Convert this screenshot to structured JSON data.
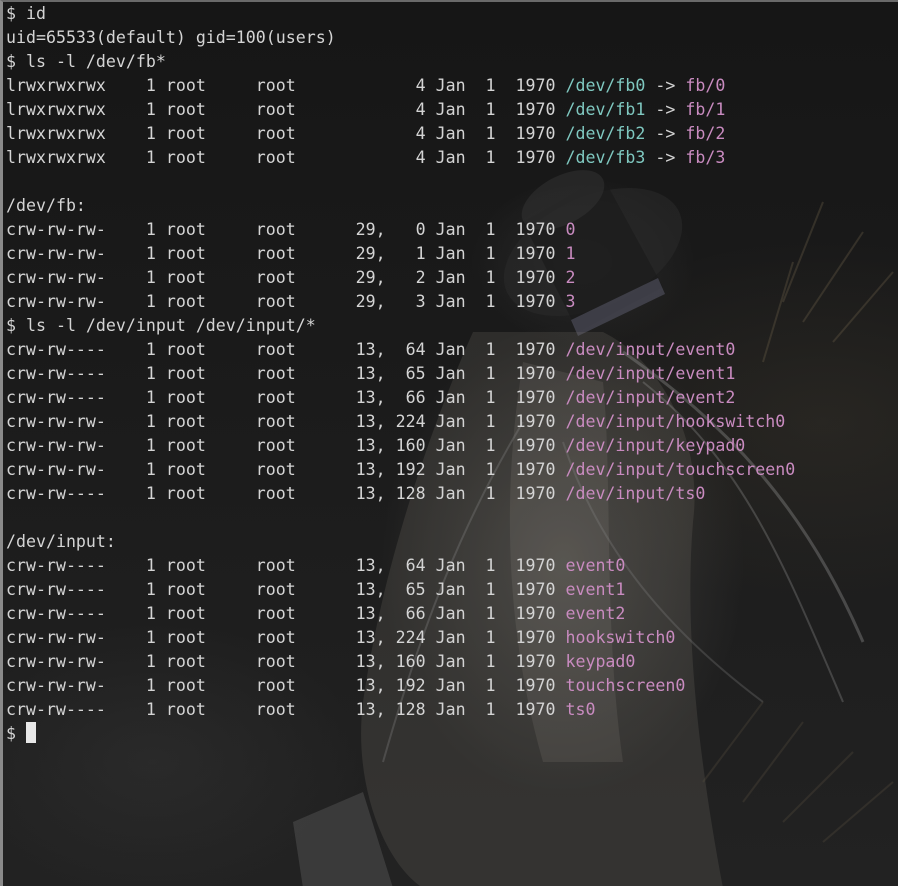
{
  "colors": {
    "text": "#d4d4d4",
    "link_path": "#7fc8c0",
    "device": "#c98bc0",
    "background": "#1c1c1c",
    "cursor": "#e8e8e8"
  },
  "prompt": "$ ",
  "lines": [
    {
      "plain": "$ id"
    },
    {
      "plain": "uid=65533(default) gid=100(users)"
    },
    {
      "plain": "$ ls -l /dev/fb*"
    },
    {
      "plain": "lrwxrwxrwx    1 root     root            4 Jan  1  1970 ",
      "blue": "/dev/fb0",
      "arrow": " -> ",
      "mag": "fb/0"
    },
    {
      "plain": "lrwxrwxrwx    1 root     root            4 Jan  1  1970 ",
      "blue": "/dev/fb1",
      "arrow": " -> ",
      "mag": "fb/1"
    },
    {
      "plain": "lrwxrwxrwx    1 root     root            4 Jan  1  1970 ",
      "blue": "/dev/fb2",
      "arrow": " -> ",
      "mag": "fb/2"
    },
    {
      "plain": "lrwxrwxrwx    1 root     root            4 Jan  1  1970 ",
      "blue": "/dev/fb3",
      "arrow": " -> ",
      "mag": "fb/3"
    },
    {
      "plain": ""
    },
    {
      "plain": "/dev/fb:"
    },
    {
      "plain": "crw-rw-rw-    1 root     root      29,   0 Jan  1  1970 ",
      "mag": "0"
    },
    {
      "plain": "crw-rw-rw-    1 root     root      29,   1 Jan  1  1970 ",
      "mag": "1"
    },
    {
      "plain": "crw-rw-rw-    1 root     root      29,   2 Jan  1  1970 ",
      "mag": "2"
    },
    {
      "plain": "crw-rw-rw-    1 root     root      29,   3 Jan  1  1970 ",
      "mag": "3"
    },
    {
      "plain": "$ ls -l /dev/input /dev/input/*"
    },
    {
      "plain": "crw-rw----    1 root     root      13,  64 Jan  1  1970 ",
      "mag": "/dev/input/event0"
    },
    {
      "plain": "crw-rw----    1 root     root      13,  65 Jan  1  1970 ",
      "mag": "/dev/input/event1"
    },
    {
      "plain": "crw-rw----    1 root     root      13,  66 Jan  1  1970 ",
      "mag": "/dev/input/event2"
    },
    {
      "plain": "crw-rw-rw-    1 root     root      13, 224 Jan  1  1970 ",
      "mag": "/dev/input/hookswitch0"
    },
    {
      "plain": "crw-rw-rw-    1 root     root      13, 160 Jan  1  1970 ",
      "mag": "/dev/input/keypad0"
    },
    {
      "plain": "crw-rw-rw-    1 root     root      13, 192 Jan  1  1970 ",
      "mag": "/dev/input/touchscreen0"
    },
    {
      "plain": "crw-rw----    1 root     root      13, 128 Jan  1  1970 ",
      "mag": "/dev/input/ts0"
    },
    {
      "plain": ""
    },
    {
      "plain": "/dev/input:"
    },
    {
      "plain": "crw-rw----    1 root     root      13,  64 Jan  1  1970 ",
      "mag": "event0"
    },
    {
      "plain": "crw-rw----    1 root     root      13,  65 Jan  1  1970 ",
      "mag": "event1"
    },
    {
      "plain": "crw-rw----    1 root     root      13,  66 Jan  1  1970 ",
      "mag": "event2"
    },
    {
      "plain": "crw-rw-rw-    1 root     root      13, 224 Jan  1  1970 ",
      "mag": "hookswitch0"
    },
    {
      "plain": "crw-rw-rw-    1 root     root      13, 160 Jan  1  1970 ",
      "mag": "keypad0"
    },
    {
      "plain": "crw-rw-rw-    1 root     root      13, 192 Jan  1  1970 ",
      "mag": "touchscreen0"
    },
    {
      "plain": "crw-rw----    1 root     root      13, 128 Jan  1  1970 ",
      "mag": "ts0"
    }
  ]
}
